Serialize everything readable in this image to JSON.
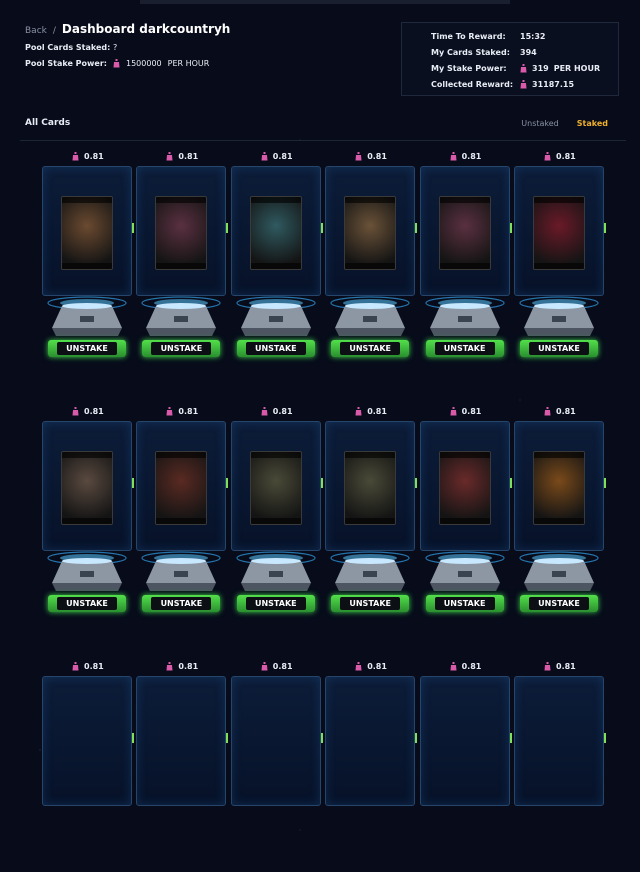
{
  "header": {
    "back_label": "Back",
    "separator": "/",
    "title": "Dashboard darkcountryh",
    "pool_cards_label": "Pool Cards Staked:",
    "pool_cards_value": "?",
    "pool_power_label": "Pool Stake Power:",
    "pool_power_value": "1500000",
    "pool_power_unit": "PER HOUR"
  },
  "rewards": {
    "time_label": "Time To Reward:",
    "time_value": "15:32",
    "cards_label": "My Cards Staked:",
    "cards_value": "394",
    "power_label": "My Stake Power:",
    "power_value": "319",
    "power_unit": "PER HOUR",
    "collected_label": "Collected Reward:",
    "collected_value": "31187.15"
  },
  "tabs": {
    "all_cards": "All Cards",
    "unstaked": "Unstaked",
    "staked": "Staked"
  },
  "colors": {
    "accent": "#f0b02a",
    "button_green": "#3fcf4a",
    "potion": "#d85aa8"
  },
  "cards": [
    {
      "cost": "0.81",
      "button": "UNSTAKE",
      "tint": "#6b4a30"
    },
    {
      "cost": "0.81",
      "button": "UNSTAKE",
      "tint": "#5a3040"
    },
    {
      "cost": "0.81",
      "button": "UNSTAKE",
      "tint": "#2f5a60"
    },
    {
      "cost": "0.81",
      "button": "UNSTAKE",
      "tint": "#6a5238"
    },
    {
      "cost": "0.81",
      "button": "UNSTAKE",
      "tint": "#5a3040"
    },
    {
      "cost": "0.81",
      "button": "UNSTAKE",
      "tint": "#6a1a28"
    },
    {
      "cost": "0.81",
      "button": "UNSTAKE",
      "tint": "#5a4a40"
    },
    {
      "cost": "0.81",
      "button": "UNSTAKE",
      "tint": "#5a2a22"
    },
    {
      "cost": "0.81",
      "button": "UNSTAKE",
      "tint": "#4a4a38"
    },
    {
      "cost": "0.81",
      "button": "UNSTAKE",
      "tint": "#4a4a38"
    },
    {
      "cost": "0.81",
      "button": "UNSTAKE",
      "tint": "#6a2a2a"
    },
    {
      "cost": "0.81",
      "button": "UNSTAKE",
      "tint": "#7a4a1a"
    },
    {
      "cost": "0.81",
      "button": "",
      "tint": "#0c1c38"
    },
    {
      "cost": "0.81",
      "button": "",
      "tint": "#0c1c38"
    },
    {
      "cost": "0.81",
      "button": "",
      "tint": "#0c1c38"
    },
    {
      "cost": "0.81",
      "button": "",
      "tint": "#0c1c38"
    },
    {
      "cost": "0.81",
      "button": "",
      "tint": "#0c1c38"
    },
    {
      "cost": "0.81",
      "button": "",
      "tint": "#0c1c38"
    }
  ]
}
